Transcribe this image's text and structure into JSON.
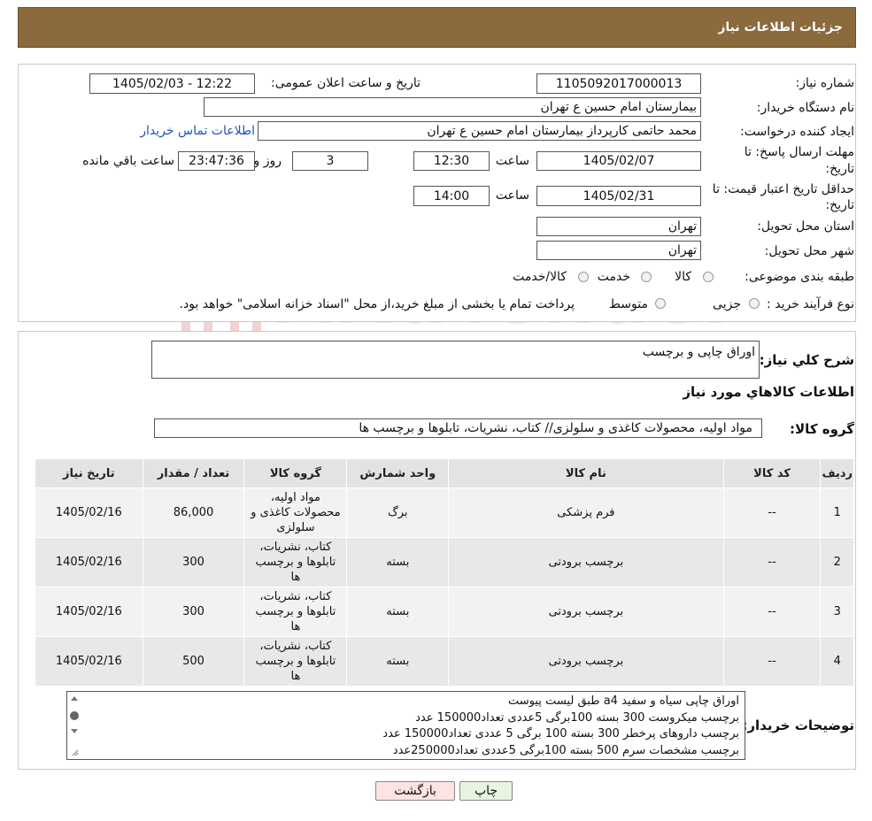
{
  "header": {
    "title": "جزئیات اطلاعات نیاز"
  },
  "form": {
    "need_number_label": "شماره نیاز:",
    "need_number": "1105092017000013",
    "announce_label": "تاریخ و ساعت اعلان عمومی:",
    "announce_value": "1405/02/03 - 12:22",
    "buyer_org_label": "نام دستگاه خریدار:",
    "buyer_org": "بیمارستان امام حسین  ع  تهران",
    "requester_label": "ایجاد کننده درخواست:",
    "requester": "محمد حاتمی کارپرداز بیمارستان امام حسین  ع  تهران",
    "contact_link": "اطلاعات تماس خریدار",
    "deadline_label_1": "مهلت ارسال پاسخ: تا",
    "deadline_label_2": "تاریخ:",
    "deadline_date": "1405/02/07",
    "time_label": "ساعت",
    "deadline_time": "12:30",
    "days_value": "3",
    "days_label": "روز و",
    "remaining_value": "23:47:36",
    "remaining_label": "ساعت باقي مانده",
    "validity_label_1": "حداقل تاریخ اعتبار قیمت: تا",
    "validity_label_2": "تاریخ:",
    "validity_date": "1405/02/31",
    "validity_time": "14:00",
    "province_label": "استان محل تحویل:",
    "province": "تهران",
    "city_label": "شهر محل تحویل:",
    "city": "تهران",
    "category_label": "طبقه بندی موضوعی:",
    "category_options": [
      "کالا",
      "خدمت",
      "کالا/خدمت"
    ],
    "process_label": "نوع فرآیند خرید :",
    "process_options": [
      "جزیی",
      "متوسط"
    ],
    "process_note": "پرداخت تمام یا بخشی از مبلغ خرید،از محل \"اسناد خزانه اسلامی\" خواهد بود."
  },
  "watermark": {
    "text": "AriaTender.neT"
  },
  "summary": {
    "label": "شرح کلي نياز:",
    "value": "اوراق چاپی و برچسب",
    "items_title": "اطلاعات كالاهاي مورد نياز",
    "group_label": "گروه کالا:",
    "group_value": "مواد اولیه، محصولات کاغذی و سلولزی// کتاب، نشریات، تابلوها و برچسب ها"
  },
  "table": {
    "headers": [
      "رديف",
      "کد کالا",
      "نام کالا",
      "واحد شمارش",
      "گروه کالا",
      "تعداد / مقدار",
      "تاریخ نیاز"
    ],
    "rows": [
      {
        "idx": "1",
        "code": "--",
        "name": "فرم پزشکی",
        "unit": "برگ",
        "group_l1": "مواد اولیه،",
        "group_l2": "محصولات کاغذی و",
        "group_l3": "سلولزی",
        "qty": "86,000",
        "date": "1405/02/16"
      },
      {
        "idx": "2",
        "code": "--",
        "name": "برچسب برودتی",
        "unit": "بسته",
        "group_l1": "کتاب، نشریات،",
        "group_l2": "تابلوها و برچسب",
        "group_l3": "ها",
        "qty": "300",
        "date": "1405/02/16"
      },
      {
        "idx": "3",
        "code": "--",
        "name": "برچسب برودتی",
        "unit": "بسته",
        "group_l1": "کتاب، نشریات،",
        "group_l2": "تابلوها و برچسب",
        "group_l3": "ها",
        "qty": "300",
        "date": "1405/02/16"
      },
      {
        "idx": "4",
        "code": "--",
        "name": "برچسب برودتی",
        "unit": "بسته",
        "group_l1": "کتاب، نشریات،",
        "group_l2": "تابلوها و برچسب",
        "group_l3": "ها",
        "qty": "500",
        "date": "1405/02/16"
      }
    ]
  },
  "notes": {
    "label": "توضیحات خریدار:",
    "lines": [
      "اوراق چاپی  سیاه و سفید  a4 طبق لیست پیوست",
      "برچسب میکروست 300 بسته 100برگی 5عددی تعداد150000 عدد",
      "برچسب داروهای پرخطر 300 بسته 100 برگی 5 عددی تعداد150000 عدد",
      "برچسب مشخصات سرم 500 بسته 100برگی 5عددی تعداد250000عدد"
    ]
  },
  "buttons": {
    "print": "چاپ",
    "back": "بازگشت"
  },
  "colors": {
    "header_bg": "#8b6a3d",
    "link": "#1f54b8",
    "back_bg": "#fde3e3",
    "print_bg": "#e6f4e0"
  }
}
